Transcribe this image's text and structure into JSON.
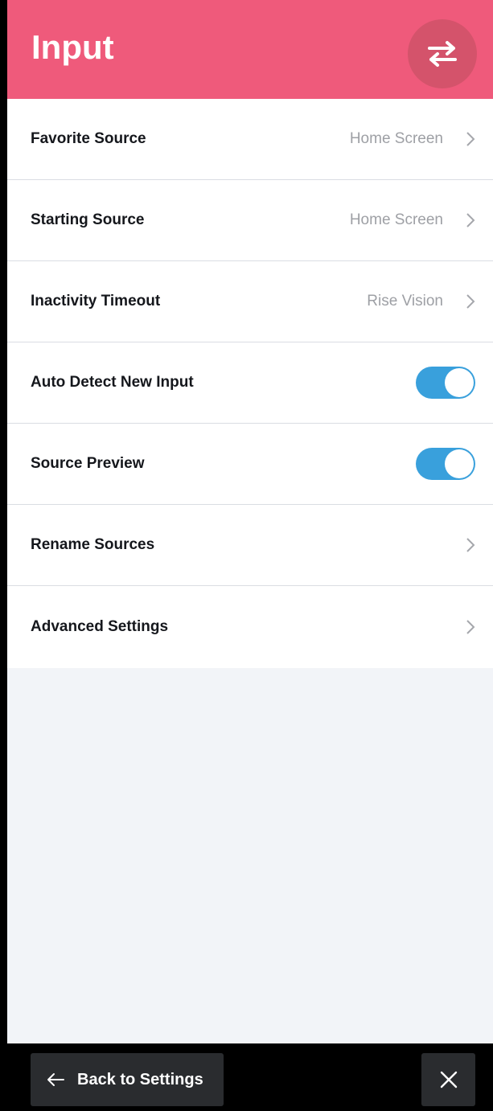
{
  "header": {
    "title": "Input",
    "action_icon": "swap-arrows-icon"
  },
  "settings": {
    "items": [
      {
        "label": "Favorite Source",
        "value": "Home Screen",
        "control": "chevron"
      },
      {
        "label": "Starting Source",
        "value": "Home Screen",
        "control": "chevron"
      },
      {
        "label": "Inactivity Timeout",
        "value": "Rise Vision",
        "control": "chevron"
      },
      {
        "label": "Auto Detect New Input",
        "control": "toggle",
        "on": true
      },
      {
        "label": "Source Preview",
        "control": "toggle",
        "on": true
      },
      {
        "label": "Rename Sources",
        "control": "chevron"
      },
      {
        "label": "Advanced Settings",
        "control": "chevron"
      }
    ]
  },
  "footer": {
    "back_label": "Back to Settings",
    "back_icon": "arrow-left-icon",
    "close_icon": "close-icon"
  },
  "colors": {
    "header": "#ef5a7b",
    "header_button": "#d4536b",
    "toggle_on": "#39a0dc",
    "background": "#f2f4f8"
  }
}
